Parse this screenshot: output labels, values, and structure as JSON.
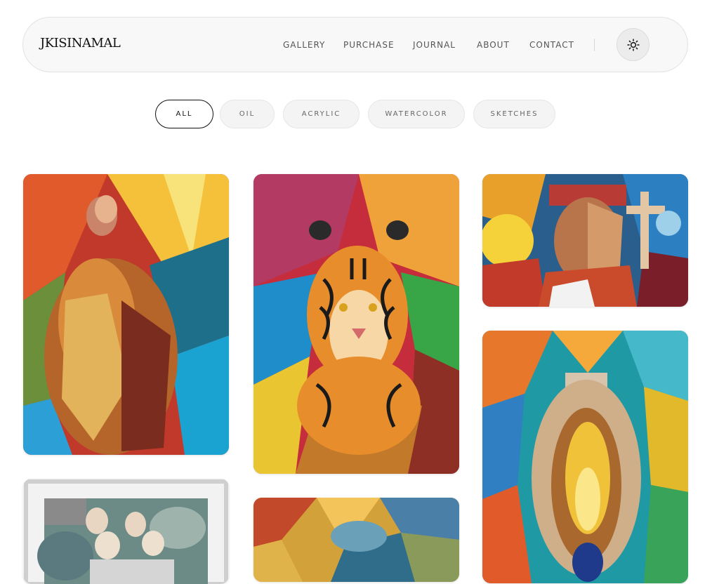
{
  "brand": {
    "name": "JKISINAMAL"
  },
  "nav": {
    "items": [
      {
        "label": "GALLERY"
      },
      {
        "label": "PURCHASE"
      },
      {
        "label": "JOURNAL"
      },
      {
        "label": "ABOUT"
      },
      {
        "label": "CONTACT"
      }
    ],
    "theme_toggle_icon": "sun-icon"
  },
  "filters": {
    "active": "ALL",
    "items": [
      {
        "label": "ALL"
      },
      {
        "label": "OIL"
      },
      {
        "label": "ACRYLIC"
      },
      {
        "label": "WATERCOLOR"
      },
      {
        "label": "SKETCHES"
      }
    ]
  },
  "gallery": {
    "artworks": [
      {
        "subject": "cubist figure with vase"
      },
      {
        "subject": "tiger"
      },
      {
        "subject": "indigenous man portrait"
      },
      {
        "subject": "vase with oil lamp"
      },
      {
        "subject": "family portrait sketch"
      },
      {
        "subject": "abstract"
      }
    ]
  }
}
